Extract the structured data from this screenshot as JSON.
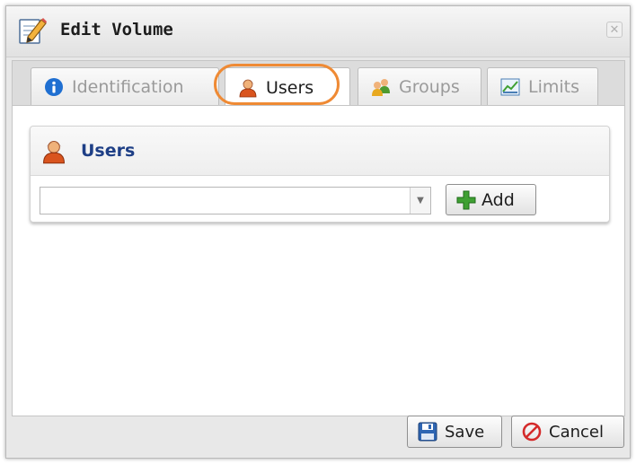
{
  "dialog": {
    "title": "Edit Volume",
    "title_icon": "edit-document-icon",
    "close_icon": "close-icon"
  },
  "tabs": [
    {
      "label": "Identification",
      "icon": "info-icon",
      "active": false
    },
    {
      "label": "Users",
      "icon": "user-icon",
      "active": true
    },
    {
      "label": "Groups",
      "icon": "group-icon",
      "active": false
    },
    {
      "label": "Limits",
      "icon": "chart-icon",
      "active": false
    }
  ],
  "users_panel": {
    "title": "Users",
    "icon": "user-icon",
    "combo": {
      "value": "",
      "trigger_icon": "dropdown-arrow-icon"
    },
    "add_label": "Add",
    "add_icon": "plus-icon"
  },
  "footer": {
    "save_label": "Save",
    "save_icon": "save-disk-icon",
    "cancel_label": "Cancel",
    "cancel_icon": "cancel-icon"
  },
  "colors": {
    "highlight": "#ef8a34",
    "header_text": "#1e3f86",
    "info_blue": "#1f6fd1",
    "add_green": "#3fa033",
    "cancel_red": "#d42a2a"
  }
}
